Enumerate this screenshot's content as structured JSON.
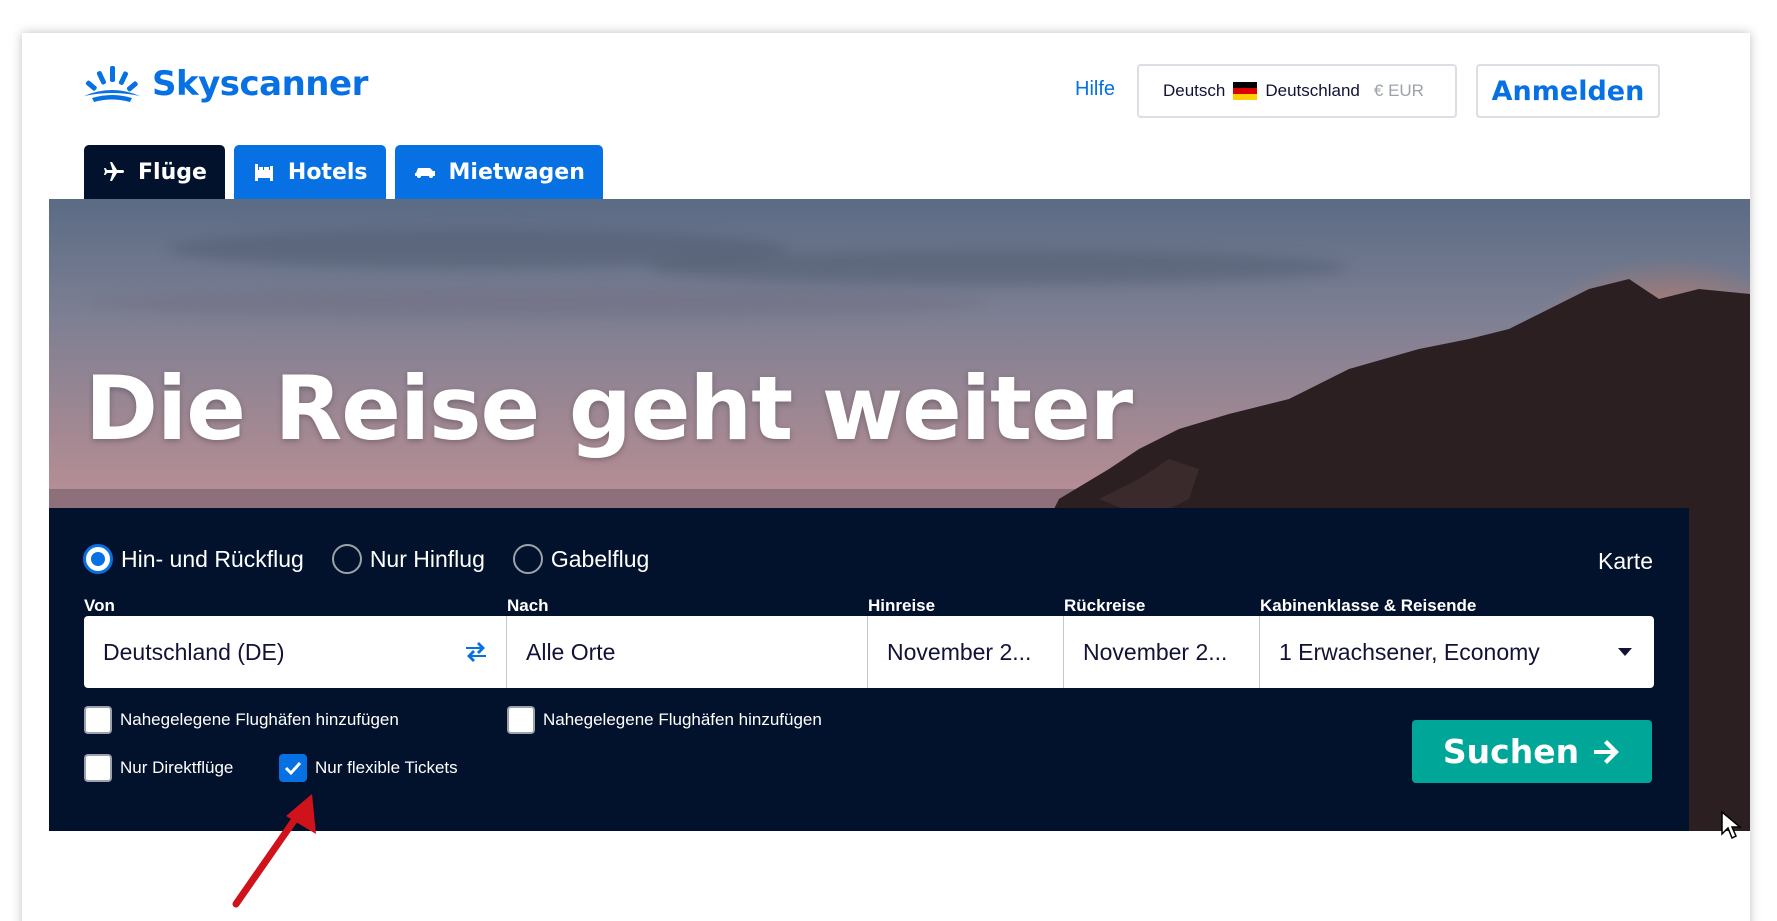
{
  "header": {
    "logo_text": "Skyscanner",
    "help_label": "Hilfe",
    "locale": {
      "language": "Deutsch",
      "country": "Deutschland",
      "currency": "€ EUR"
    },
    "login_label": "Anmelden"
  },
  "tabs": [
    {
      "label": "Flüge",
      "icon": "plane-icon",
      "active": true
    },
    {
      "label": "Hotels",
      "icon": "bed-icon",
      "active": false
    },
    {
      "label": "Mietwagen",
      "icon": "car-icon",
      "active": false
    }
  ],
  "hero": {
    "title": "Die Reise geht weiter"
  },
  "search": {
    "trip_types": [
      {
        "label": "Hin- und Rückflug",
        "selected": true
      },
      {
        "label": "Nur Hinflug",
        "selected": false
      },
      {
        "label": "Gabelflug",
        "selected": false
      }
    ],
    "map_label": "Karte",
    "labels": {
      "from": "Von",
      "to": "Nach",
      "depart": "Hinreise",
      "return": "Rückreise",
      "cabin": "Kabinenklasse & Reisende"
    },
    "values": {
      "from": "Deutschland (DE)",
      "to": "Alle Orte",
      "depart": "November 2...",
      "return": "November 2...",
      "cabin": "1 Erwachsener, Economy"
    },
    "checkboxes": {
      "nearby_from": {
        "label": "Nahegelegene Flughäfen hinzufügen",
        "checked": false
      },
      "nearby_to": {
        "label": "Nahegelegene Flughäfen hinzufügen",
        "checked": false
      },
      "direct_only": {
        "label": "Nur Direktflüge",
        "checked": false
      },
      "flexible_only": {
        "label": "Nur flexible Tickets",
        "checked": true
      }
    },
    "search_label": "Suchen"
  },
  "colors": {
    "brand_blue": "#0770e3",
    "panel_navy": "#02122c",
    "search_green": "#00a698",
    "annotation_red": "#d0121a"
  }
}
